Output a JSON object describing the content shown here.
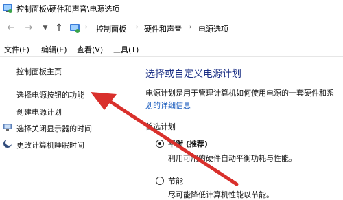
{
  "window": {
    "title": "控制面板\\硬件和声音\\电源选项"
  },
  "address": {
    "crumbs": [
      "控制面板",
      "硬件和声音",
      "电源选项"
    ]
  },
  "menu": {
    "items": [
      "文件(F)",
      "编辑(E)",
      "查看(V)",
      "工具(T)"
    ]
  },
  "sidebar": {
    "items": [
      {
        "label": "控制面板主页"
      },
      {
        "label": "选择电源按钮的功能"
      },
      {
        "label": "创建电源计划"
      },
      {
        "label": "选择关闭显示器的时间"
      },
      {
        "label": "更改计算机睡眠时间"
      }
    ]
  },
  "main": {
    "title": "选择或自定义电源计划",
    "description": "电源计划是用于管理计算机如何使用电源的一套硬件和系",
    "link": "划的详细信息",
    "section": "首选计划",
    "plans": [
      {
        "name": "平衡 (推荐)",
        "desc": "利用可用的硬件自动平衡功耗与性能。",
        "selected": true
      },
      {
        "name": "节能",
        "desc": "尽可能降低计算机性能以节能。",
        "selected": false
      }
    ]
  },
  "annotation": {
    "arrow_color": "#d9302c"
  }
}
